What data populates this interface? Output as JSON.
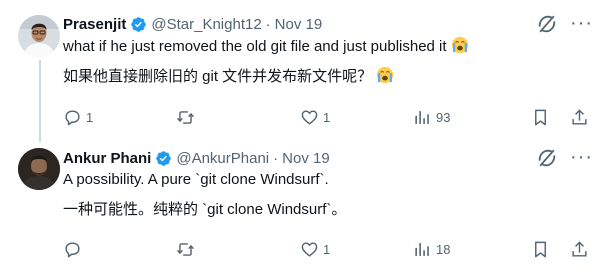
{
  "tweets": [
    {
      "author_name": "Prasenjit",
      "handle": "@Star_Knight12",
      "separator": "·",
      "date": "Nov 19",
      "line1": "what if he just removed the old git file and just published it",
      "line2": "如果他直接删除旧的 git 文件并发布新文件呢？",
      "reply_count": "1",
      "retweet_count": "",
      "like_count": "1",
      "view_count": "93"
    },
    {
      "author_name": "Ankur Phani",
      "handle": "@AnkurPhani",
      "separator": "·",
      "date": "Nov 19",
      "line1": "A possibility. A pure `git clone Windsurf`.",
      "line2": "一种可能性。纯粹的 `git clone Windsurf`。",
      "reply_count": "",
      "retweet_count": "",
      "like_count": "1",
      "view_count": "18"
    }
  ],
  "icons": [
    "verified-badge-icon",
    "grok-icon",
    "more-icon",
    "reply-icon",
    "retweet-icon",
    "like-icon",
    "views-icon",
    "bookmark-icon",
    "share-icon",
    "crying-face-emoji-icon"
  ],
  "colors": {
    "verified": "#1d9bf0",
    "muted": "#536471",
    "text": "#0f1419",
    "thread_line": "#cfd9de"
  }
}
